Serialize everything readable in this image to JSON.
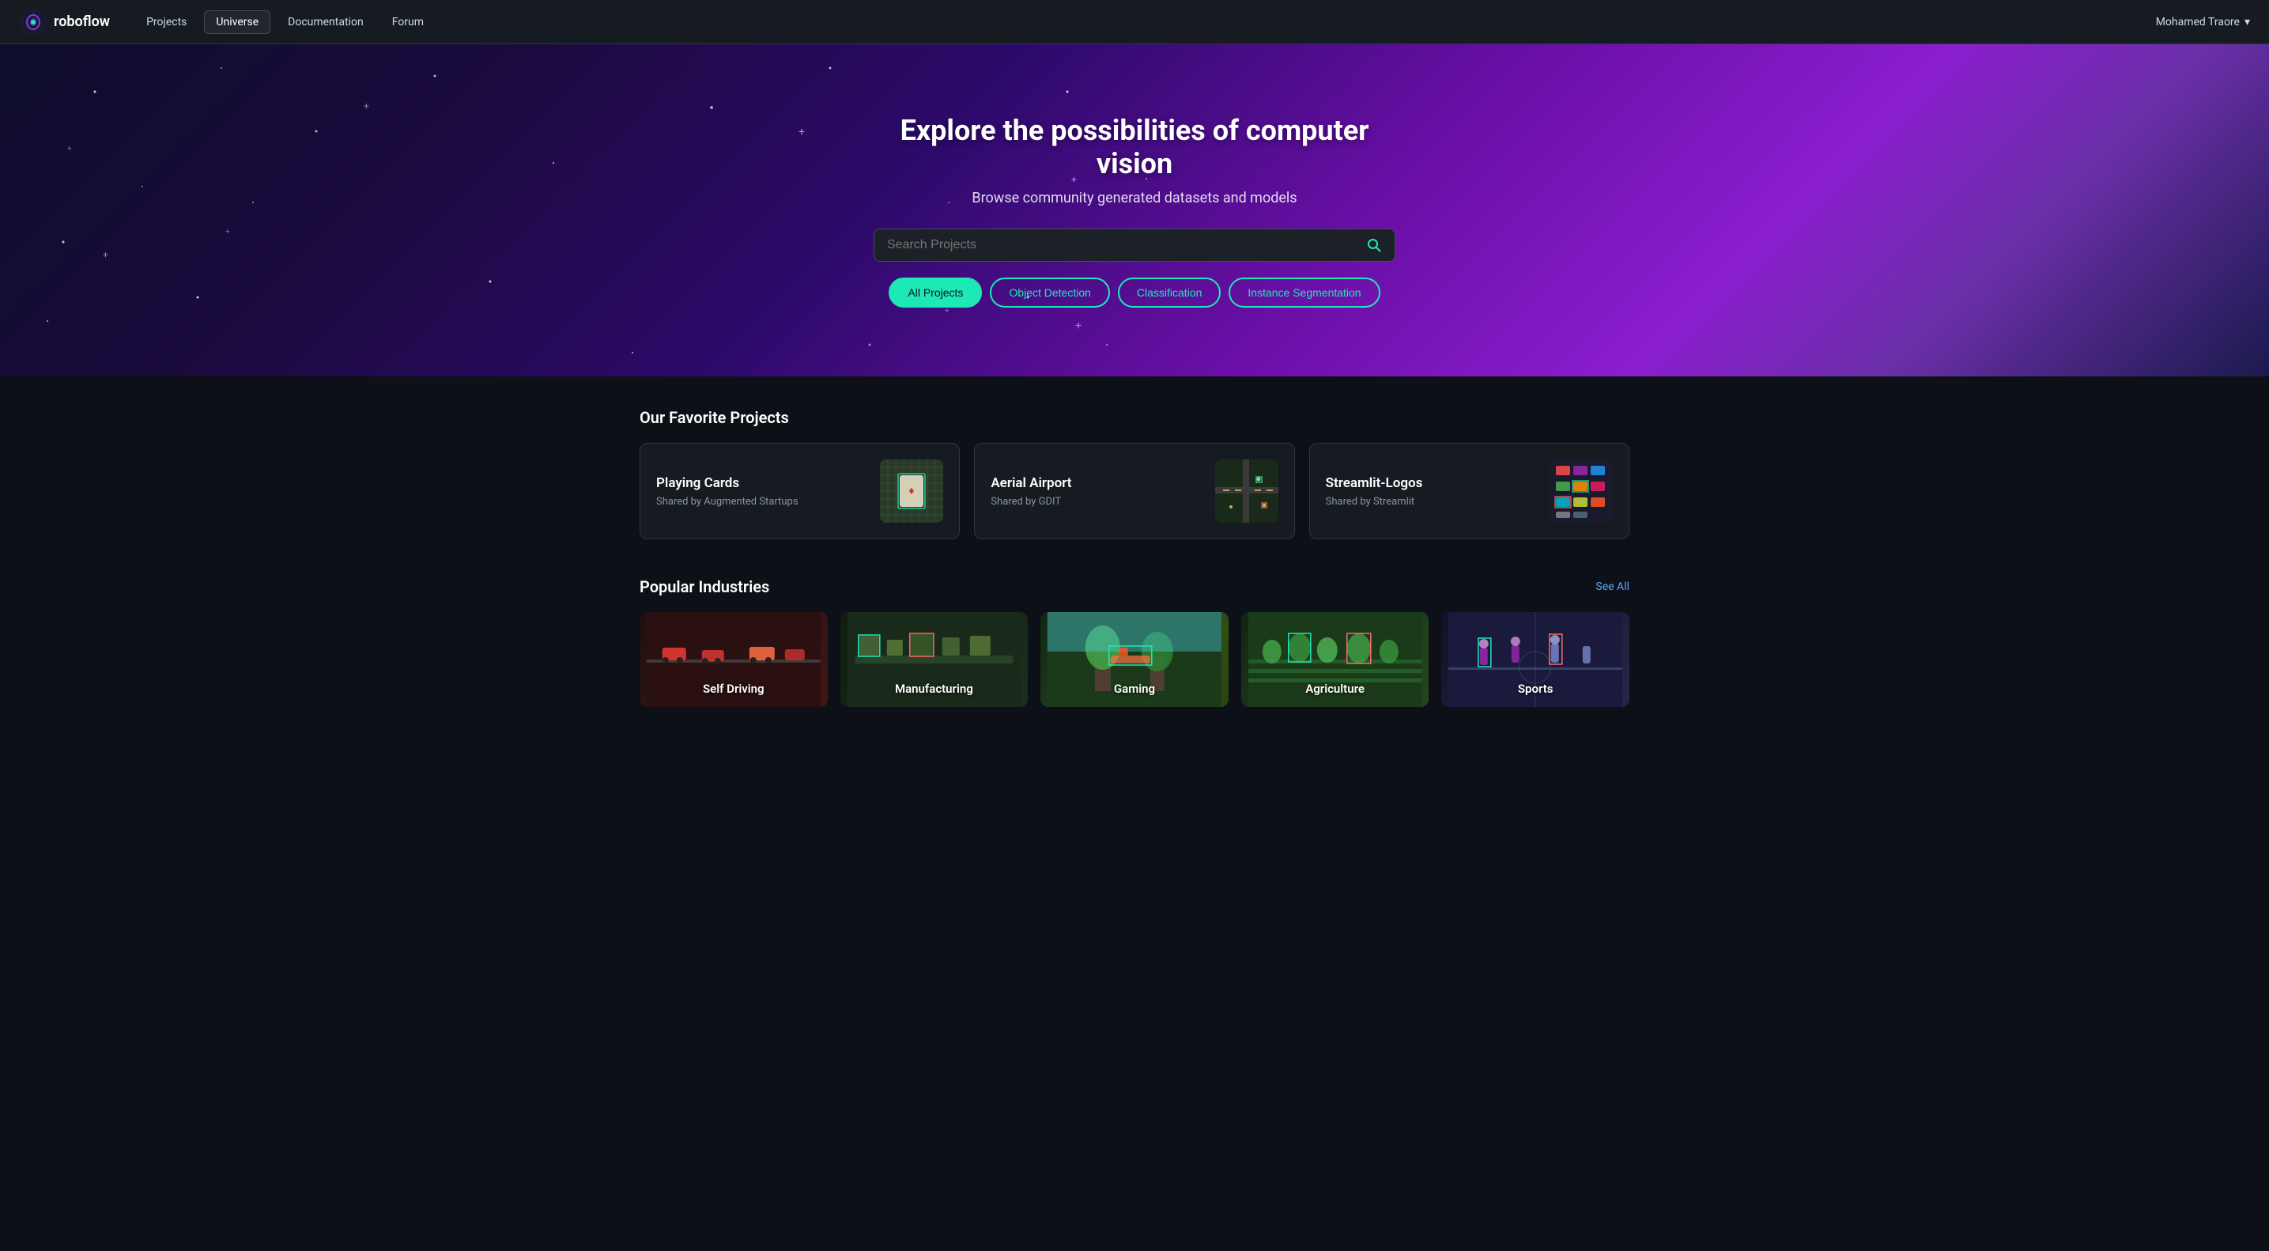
{
  "navbar": {
    "logo_text": "roboflow",
    "links": [
      {
        "id": "projects",
        "label": "Projects",
        "active": false
      },
      {
        "id": "universe",
        "label": "Universe",
        "active": true
      },
      {
        "id": "documentation",
        "label": "Documentation",
        "active": false
      },
      {
        "id": "forum",
        "label": "Forum",
        "active": false
      }
    ],
    "user": "Mohamed Traore",
    "dropdown_icon": "▾"
  },
  "hero": {
    "title": "Explore the possibilities of computer vision",
    "subtitle": "Browse community generated datasets and models",
    "search_placeholder": "Search Projects",
    "search_icon": "🔍",
    "filters": [
      {
        "id": "all",
        "label": "All Projects",
        "active": true
      },
      {
        "id": "object_detection",
        "label": "Object Detection",
        "active": false
      },
      {
        "id": "classification",
        "label": "Classification",
        "active": false
      },
      {
        "id": "instance_segmentation",
        "label": "Instance Segmentation",
        "active": false
      }
    ]
  },
  "favorite_projects": {
    "section_title": "Our Favorite Projects",
    "projects": [
      {
        "id": "playing-cards",
        "name": "Playing Cards",
        "author": "Shared by Augmented Startups",
        "thumb_type": "playing-cards"
      },
      {
        "id": "aerial-airport",
        "name": "Aerial Airport",
        "author": "Shared by GDIT",
        "thumb_type": "aerial"
      },
      {
        "id": "streamlit-logos",
        "name": "Streamlit-Logos",
        "author": "Shared by Streamlit",
        "thumb_type": "streamlit"
      }
    ]
  },
  "popular_industries": {
    "section_title": "Popular Industries",
    "see_all_label": "See All",
    "industries": [
      {
        "id": "self-driving",
        "label": "Self Driving",
        "bg_class": "ind-selfdriving"
      },
      {
        "id": "manufacturing",
        "label": "Manufacturing",
        "bg_class": "ind-manufacturing"
      },
      {
        "id": "gaming",
        "label": "Gaming",
        "bg_class": "ind-gaming"
      },
      {
        "id": "agriculture",
        "label": "Agriculture",
        "bg_class": "ind-agriculture"
      },
      {
        "id": "sports",
        "label": "Sports",
        "bg_class": "ind-sports"
      }
    ]
  }
}
